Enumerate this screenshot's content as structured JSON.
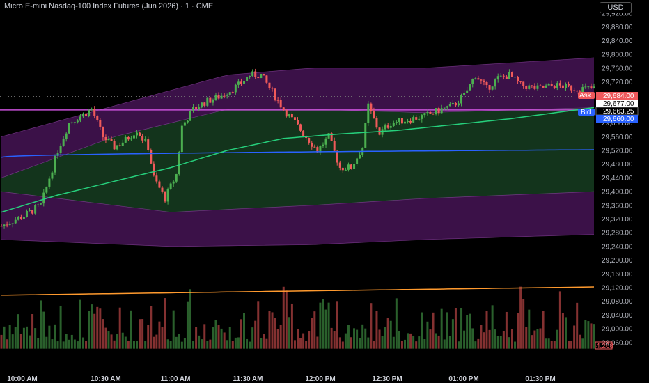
{
  "header": {
    "title": "Micro E-mini Nasdaq-100 Index Futures (Jun 2026) · 1 · CME",
    "currency": "USD"
  },
  "colors": {
    "background": "#000000",
    "up": "#26a69a",
    "up_candle": "#4caf50",
    "down_candle": "#f05a5a",
    "outer_band": "#3b1148",
    "inner_band": "#13341c",
    "band_edge": "#a04cb8",
    "vwap": "#2962ff",
    "ma_green": "#26d07c",
    "horizontal_line": "#c850d8",
    "volume_ma": "#ff9a2e",
    "ask": "#f0595c",
    "bid": "#2962ff"
  },
  "price_axis": {
    "ticks": [
      "29,920.00",
      "29,880.00",
      "29,840.00",
      "29,800.00",
      "29,760.00",
      "29,720.00",
      "29,680.00",
      "29,640.00",
      "29,600.00",
      "29,560.00",
      "29,520.00",
      "29,480.00",
      "29,440.00",
      "29,400.00",
      "29,360.00",
      "29,320.00",
      "29,280.00",
      "29,240.00",
      "29,200.00",
      "29,160.00",
      "29,120.00",
      "29,080.00",
      "29,040.00",
      "29,000.00",
      "28,960.00"
    ]
  },
  "price_tags": {
    "ask_label": "Ask",
    "ask_value": "29,684.00",
    "last_value": "29,677.00",
    "mid_value": "29,663.25",
    "bid_label": "Bid",
    "bid_value": "29,660.00"
  },
  "volume_tag": "4,268",
  "time_axis": {
    "labels": [
      "10:00 AM",
      "10:30 AM",
      "11:00 AM",
      "11:30 AM",
      "12:00 PM",
      "12:30 PM",
      "01:00 PM",
      "01:30 PM"
    ]
  },
  "chart_data": {
    "type": "candlestick",
    "title": "Micro E-mini Nasdaq-100 Index Futures (Jun 2026) · 1 · CME",
    "x_range": [
      "09:50 AM",
      "01:53 PM"
    ],
    "ylim": [
      28940,
      29940
    ],
    "close_path": [
      [
        0,
        29300
      ],
      [
        8,
        29330
      ],
      [
        14,
        29360
      ],
      [
        20,
        29520
      ],
      [
        24,
        29600
      ],
      [
        28,
        29620
      ],
      [
        32,
        29640
      ],
      [
        36,
        29560
      ],
      [
        40,
        29530
      ],
      [
        44,
        29550
      ],
      [
        48,
        29580
      ],
      [
        52,
        29530
      ],
      [
        54,
        29440
      ],
      [
        58,
        29380
      ],
      [
        62,
        29450
      ],
      [
        64,
        29590
      ],
      [
        68,
        29640
      ],
      [
        72,
        29660
      ],
      [
        78,
        29680
      ],
      [
        84,
        29710
      ],
      [
        88,
        29740
      ],
      [
        92,
        29740
      ],
      [
        96,
        29690
      ],
      [
        100,
        29640
      ],
      [
        104,
        29600
      ],
      [
        108,
        29560
      ],
      [
        112,
        29520
      ],
      [
        116,
        29560
      ],
      [
        120,
        29470
      ],
      [
        124,
        29470
      ],
      [
        128,
        29530
      ],
      [
        130,
        29650
      ],
      [
        134,
        29570
      ],
      [
        138,
        29600
      ],
      [
        144,
        29610
      ],
      [
        150,
        29620
      ],
      [
        156,
        29640
      ],
      [
        160,
        29650
      ],
      [
        164,
        29680
      ],
      [
        168,
        29740
      ],
      [
        172,
        29700
      ],
      [
        176,
        29730
      ],
      [
        180,
        29740
      ],
      [
        184,
        29710
      ],
      [
        190,
        29700
      ],
      [
        196,
        29710
      ],
      [
        204,
        29700
      ],
      [
        210,
        29700
      ]
    ],
    "vwap": {
      "start": 29500,
      "end": 29522
    },
    "ma_green": [
      [
        0,
        29340
      ],
      [
        20,
        29390
      ],
      [
        40,
        29430
      ],
      [
        60,
        29470
      ],
      [
        80,
        29520
      ],
      [
        100,
        29555
      ],
      [
        120,
        29568
      ],
      [
        140,
        29578
      ],
      [
        160,
        29595
      ],
      [
        180,
        29612
      ],
      [
        210,
        29645
      ]
    ],
    "band_outer_upper": [
      [
        0,
        29560
      ],
      [
        40,
        29650
      ],
      [
        80,
        29740
      ],
      [
        110,
        29760
      ],
      [
        150,
        29760
      ],
      [
        210,
        29790
      ]
    ],
    "band_inner_upper": [
      [
        0,
        29440
      ],
      [
        40,
        29560
      ],
      [
        80,
        29640
      ],
      [
        110,
        29640
      ],
      [
        150,
        29630
      ],
      [
        210,
        29645
      ]
    ],
    "band_inner_lower": [
      [
        0,
        29400
      ],
      [
        60,
        29340
      ],
      [
        110,
        29360
      ],
      [
        150,
        29380
      ],
      [
        210,
        29400
      ]
    ],
    "band_outer_lower": [
      [
        0,
        29260
      ],
      [
        60,
        29240
      ],
      [
        110,
        29245
      ],
      [
        150,
        29260
      ],
      [
        210,
        29275
      ]
    ],
    "horizontal_level": 29638,
    "volume_ma": {
      "start": 29098,
      "end": 29122
    },
    "ask": 29684.0,
    "last": 29677.0,
    "mid": 29663.25,
    "bid": 29660.0,
    "last_volume": 4268
  }
}
